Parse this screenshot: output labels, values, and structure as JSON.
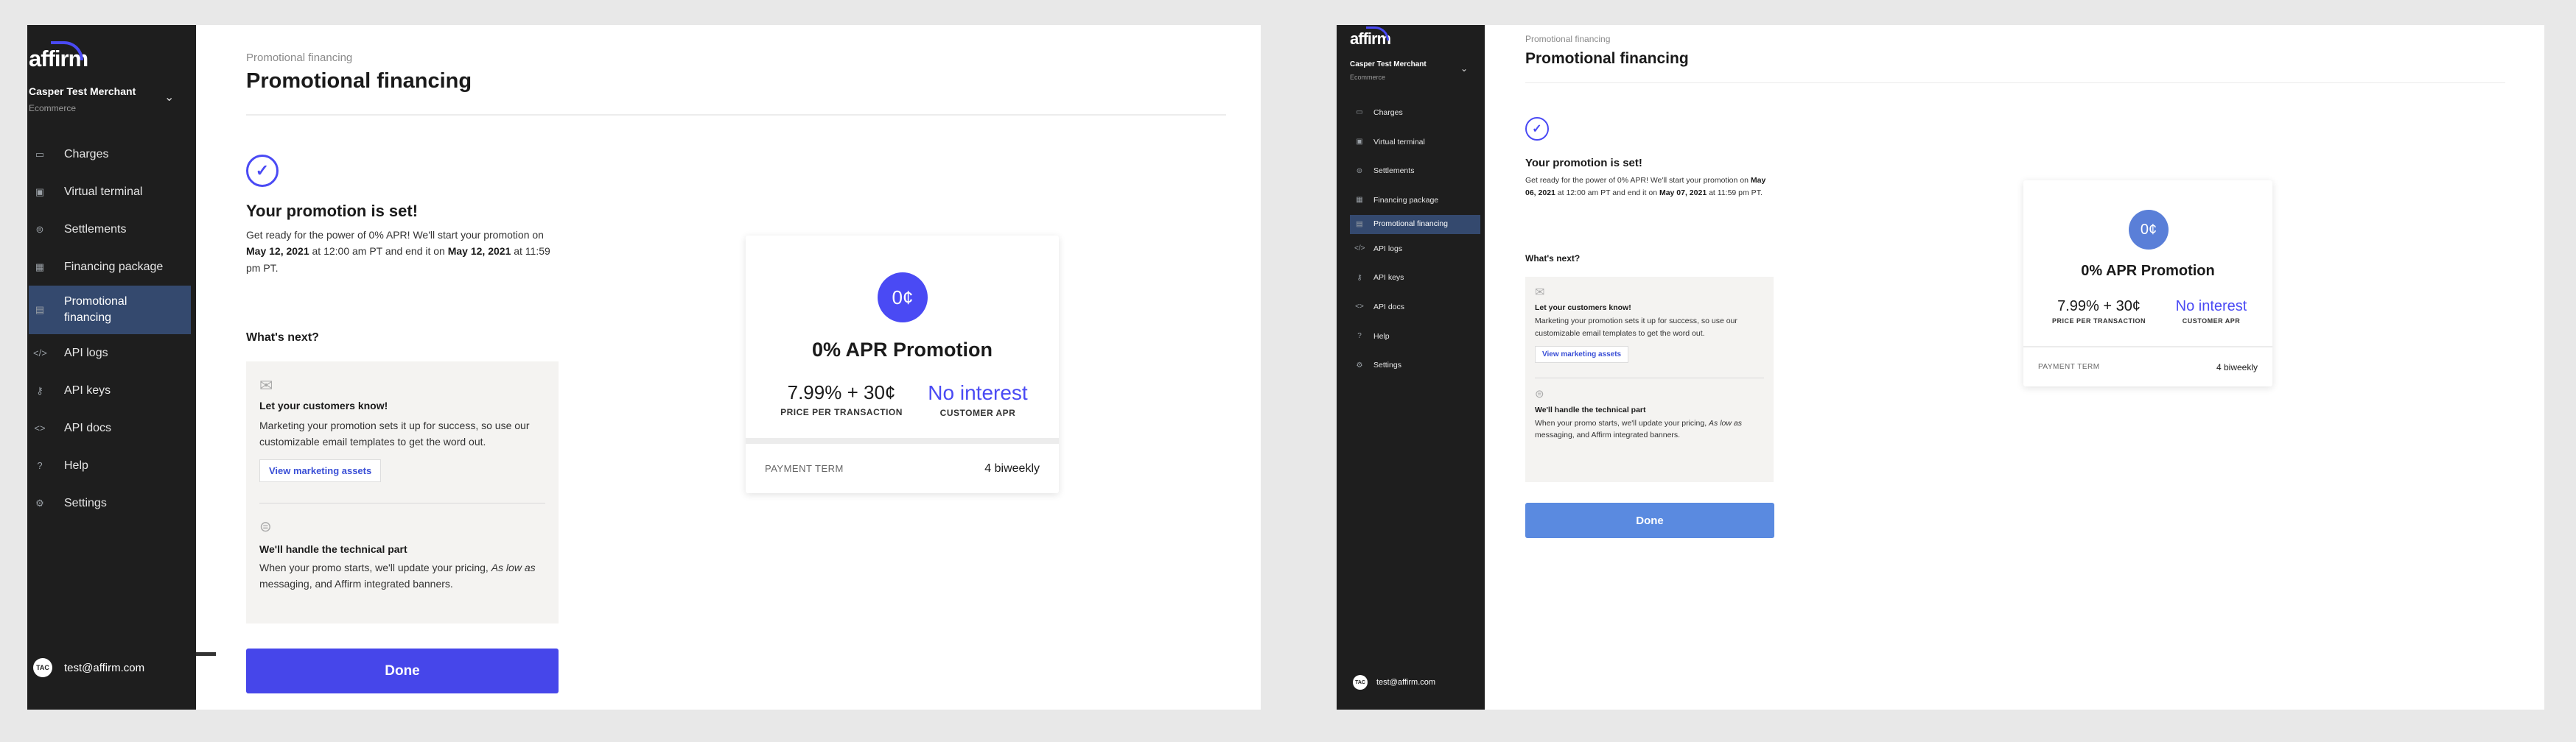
{
  "colors": {
    "accent": "#4a4af4",
    "sidebar": "#1e1e1e",
    "active_nav": "#34496e",
    "done_left": "#4646ea",
    "done_right": "#5a8ae0",
    "badge_right": "#5a7fd8"
  },
  "left": {
    "logo": "affirm",
    "merchant_name": "Casper Test Merchant",
    "merchant_sub": "Ecommerce",
    "nav": [
      {
        "label": "Charges",
        "icon": "card-icon"
      },
      {
        "label": "Virtual terminal",
        "icon": "monitor-icon"
      },
      {
        "label": "Settlements",
        "icon": "dollar-circle-icon"
      },
      {
        "label": "Financing package",
        "icon": "calendar-icon"
      },
      {
        "label": "Promotional financing",
        "icon": "document-icon"
      },
      {
        "label": "API logs",
        "icon": "code-icon"
      },
      {
        "label": "API keys",
        "icon": "key-icon"
      },
      {
        "label": "API docs",
        "icon": "angle-brackets-icon"
      },
      {
        "label": "Help",
        "icon": "help-icon"
      },
      {
        "label": "Settings",
        "icon": "gear-icon"
      }
    ],
    "avatar": "TAC",
    "user_email": "test@affirm.com",
    "breadcrumb": "Promotional financing",
    "page_title": "Promotional financing",
    "success_title": "Your promotion is set!",
    "success_text_1": "Get ready for the power of 0% APR! We'll start your promotion on",
    "start_date": "May 12, 2021",
    "success_text_2": "at 12:00 am PT and end it on",
    "end_date": "May 12, 2021",
    "success_text_3": "at 11:59 pm PT.",
    "whats_next": "What's next?",
    "panel": {
      "step1_title": "Let your customers know!",
      "step1_text": "Marketing your promotion sets it up for success, so use our customizable email templates to get the word out.",
      "step1_button": "View marketing assets",
      "step2_title": "We'll handle the technical part",
      "step2_text_1": "When your promo starts, we'll update your pricing,",
      "step2_italic": "As low as",
      "step2_text_2": "messaging, and Affirm integrated banners."
    },
    "done_button": "Done",
    "card": {
      "badge": "0¢",
      "title": "0% APR Promotion",
      "price": "7.99% + 30¢",
      "price_label": "PRICE PER TRANSACTION",
      "apr": "No interest",
      "apr_label": "CUSTOMER APR",
      "term_label": "PAYMENT TERM",
      "term_value": "4 biweekly"
    }
  },
  "right": {
    "logo": "affirm",
    "merchant_name": "Casper Test Merchant",
    "merchant_sub": "Ecommerce",
    "nav": [
      {
        "label": "Charges",
        "icon": "card-icon"
      },
      {
        "label": "Virtual terminal",
        "icon": "monitor-icon"
      },
      {
        "label": "Settlements",
        "icon": "dollar-circle-icon"
      },
      {
        "label": "Financing package",
        "icon": "calendar-icon"
      },
      {
        "label": "Promotional financing",
        "icon": "document-icon"
      },
      {
        "label": "API logs",
        "icon": "code-icon"
      },
      {
        "label": "API keys",
        "icon": "key-icon"
      },
      {
        "label": "API docs",
        "icon": "angle-brackets-icon"
      },
      {
        "label": "Help",
        "icon": "help-icon"
      },
      {
        "label": "Settings",
        "icon": "gear-icon"
      }
    ],
    "avatar": "TAC",
    "user_email": "test@affirm.com",
    "breadcrumb": "Promotional financing",
    "page_title": "Promotional financing",
    "success_title": "Your promotion is set!",
    "success_text_1": "Get ready for the power of 0% APR! We'll start your promotion on",
    "start_date": "May 06, 2021",
    "success_text_2": "at 12:00 am PT and end it on",
    "end_date": "May 07, 2021",
    "success_text_3": "at 11:59 pm PT.",
    "whats_next": "What's next?",
    "panel": {
      "step1_title": "Let your customers know!",
      "step1_text": "Marketing your promotion sets it up for success, so use our customizable email templates to get the word out.",
      "step1_button": "View marketing assets",
      "step2_title": "We'll handle the technical part",
      "step2_text_1": "When your promo starts, we'll update your pricing,",
      "step2_italic": "As low as",
      "step2_text_2": "messaging, and Affirm integrated banners."
    },
    "done_button": "Done",
    "card": {
      "badge": "0¢",
      "title": "0% APR Promotion",
      "price": "7.99% + 30¢",
      "price_label": "PRICE PER TRANSACTION",
      "apr": "No interest",
      "apr_label": "CUSTOMER APR",
      "term_label": "PAYMENT TERM",
      "term_value": "4 biweekly"
    }
  }
}
